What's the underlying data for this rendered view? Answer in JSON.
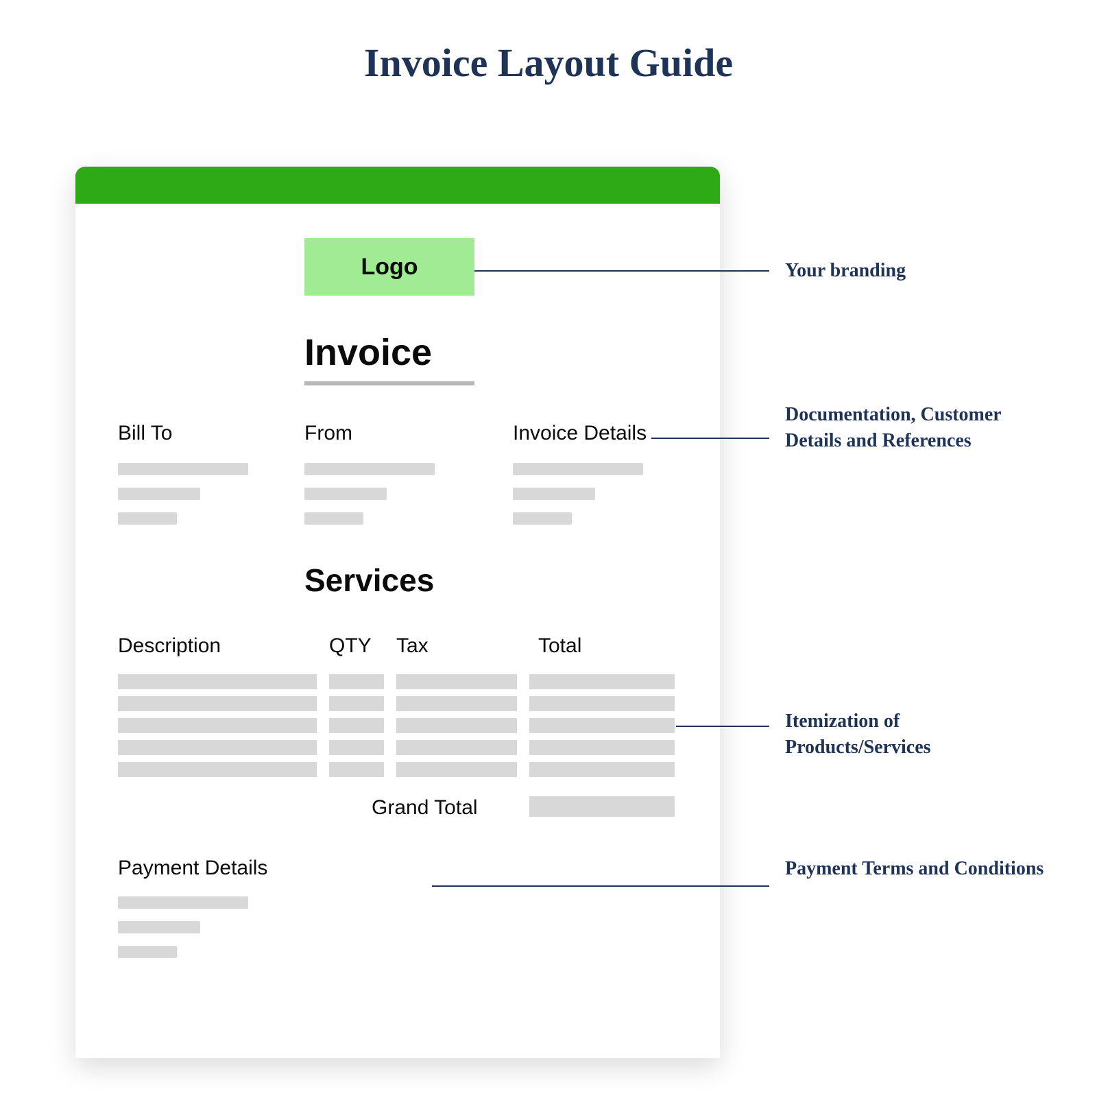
{
  "title": "Invoice Layout Guide",
  "card": {
    "logo_label": "Logo",
    "invoice_heading": "Invoice",
    "sections": {
      "bill_to": "Bill To",
      "from": "From",
      "invoice_details": "Invoice Details"
    },
    "services_heading": "Services",
    "columns": {
      "description": "Description",
      "qty": "QTY",
      "tax": "Tax",
      "total": "Total"
    },
    "grand_total_label": "Grand Total",
    "payment_details_label": "Payment Details"
  },
  "annotations": {
    "branding": "Your branding",
    "doc_refs": "Documentation, Customer Details and References",
    "itemization": "Itemization of Products/Services",
    "payment_terms": "Payment Terms and Conditions"
  },
  "colors": {
    "accent": "#2eaa17",
    "logo_bg": "#a0eb93",
    "annotation": "#1f3356",
    "placeholder": "#d8d8d8"
  }
}
